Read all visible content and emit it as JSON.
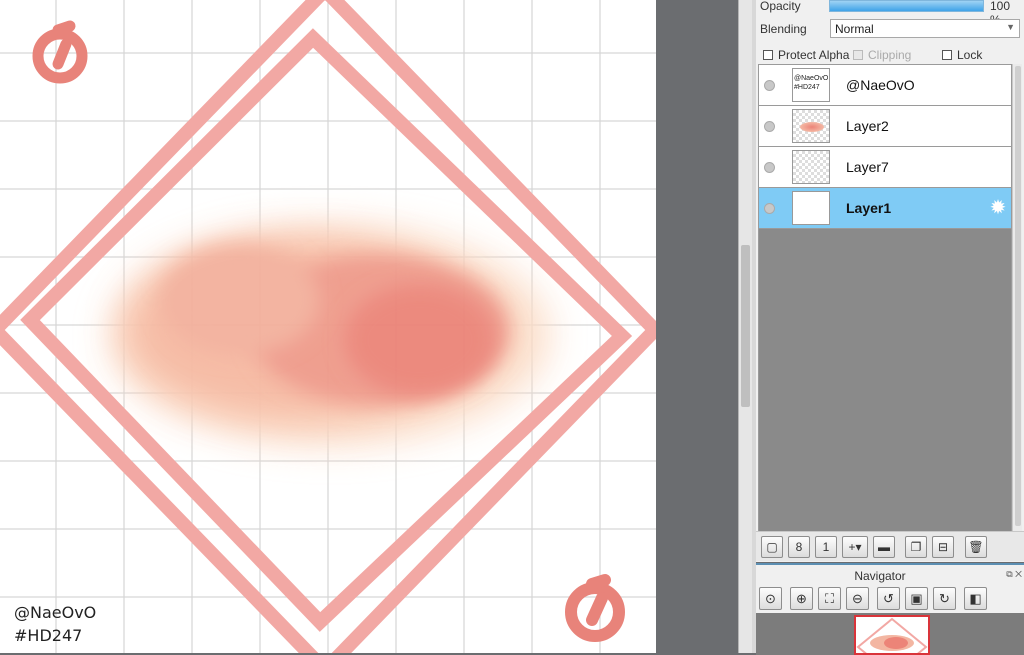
{
  "canvas": {
    "credit_line1": "@NaeOvO",
    "credit_line2": "#HD247",
    "colors": {
      "grid": "#d6d6d6",
      "frame": "#f2a8a4",
      "logo": "#e8837a",
      "paint_core": "#ec8478",
      "paint_edge": "#f8cdb2"
    }
  },
  "layer_props": {
    "opacity_label": "Opacity",
    "opacity_value": "100 %",
    "blending_label": "Blending",
    "blending_value": "Normal",
    "protect_alpha_label": "Protect Alpha",
    "clipping_label": "Clipping",
    "lock_label": "Lock"
  },
  "layers": [
    {
      "name": "@NaeOvO",
      "thumb_text": "@NaeOvO\n#HD247",
      "selected": false
    },
    {
      "name": "Layer2",
      "selected": false
    },
    {
      "name": "Layer7",
      "selected": false
    },
    {
      "name": "Layer1",
      "selected": true
    }
  ],
  "layer_toolbar": {
    "icons": [
      "new-layer-icon",
      "new-8bit-layer-icon",
      "new-1bit-layer-icon",
      "add-layer-menu-icon",
      "new-folder-icon",
      "duplicate-layer-icon",
      "merge-layer-icon",
      "delete-layer-icon"
    ]
  },
  "navigator": {
    "title": "Navigator",
    "icons": [
      "zoom-reset-icon",
      "zoom-in-icon",
      "fit-screen-icon",
      "zoom-out-icon",
      "rotate-left-icon",
      "fit-rotate-icon",
      "rotate-right-icon",
      "flip-horizontal-icon"
    ]
  },
  "accent_colors": {
    "selection": "#7fcbf5",
    "opacity_bar": "#3fa3e8",
    "navigator_frame": "#d9343a"
  }
}
